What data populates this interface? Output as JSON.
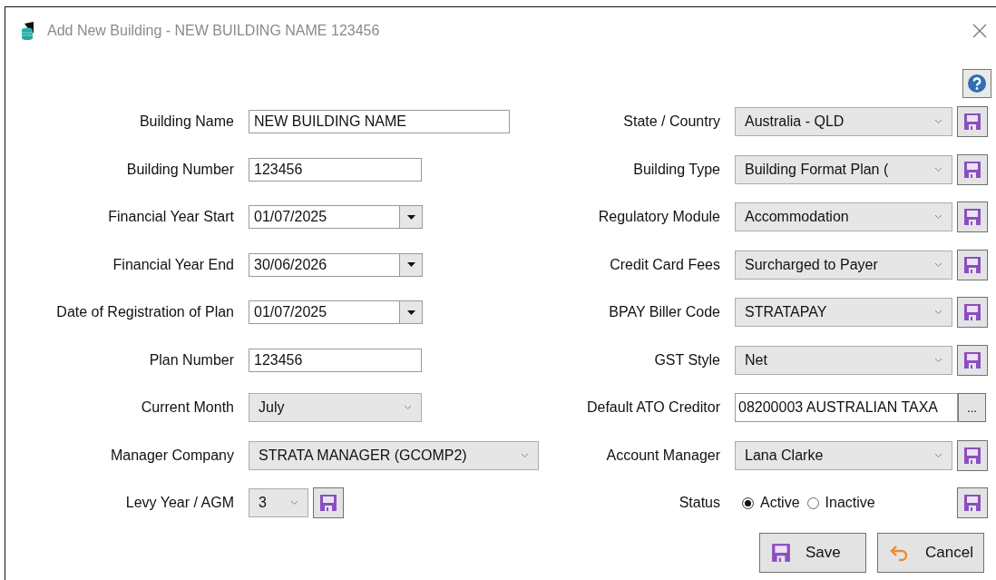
{
  "window": {
    "title": "Add New Building - NEW BUILDING NAME 123456"
  },
  "left_fields": [
    {
      "label": "Building Name",
      "kind": "text",
      "value": "NEW BUILDING NAME"
    },
    {
      "label": "Building Number",
      "kind": "text",
      "value": "123456"
    },
    {
      "label": "Financial Year Start",
      "kind": "date",
      "value": "01/07/2025"
    },
    {
      "label": "Financial Year End",
      "kind": "date",
      "value": "30/06/2026"
    },
    {
      "label": "Date of Registration of Plan",
      "kind": "date",
      "value": "01/07/2025"
    },
    {
      "label": "Plan Number",
      "kind": "text",
      "value": "123456"
    },
    {
      "label": "Current Month",
      "kind": "select",
      "value": "July"
    },
    {
      "label": "Manager Company",
      "kind": "select",
      "value": "STRATA MANAGER (GCOMP2)"
    },
    {
      "label": "Levy Year / AGM",
      "kind": "select_save",
      "value": "3"
    }
  ],
  "right_fields": [
    {
      "label": "State / Country",
      "kind": "select",
      "value": "Australia - QLD"
    },
    {
      "label": "Building Type",
      "kind": "select",
      "value": "Building Format Plan ("
    },
    {
      "label": "Regulatory Module",
      "kind": "select",
      "value": "Accommodation"
    },
    {
      "label": "Credit Card Fees",
      "kind": "select",
      "value": "Surcharged to Payer"
    },
    {
      "label": "BPAY Biller Code",
      "kind": "select",
      "value": "STRATAPAY"
    },
    {
      "label": "GST Style",
      "kind": "select",
      "value": "Net"
    },
    {
      "label": "Default ATO Creditor",
      "kind": "lookup",
      "value": "08200003 AUSTRALIAN TAXA",
      "button": "..."
    },
    {
      "label": "Account Manager",
      "kind": "select",
      "value": "Lana Clarke"
    },
    {
      "label": "Status",
      "kind": "radio",
      "options": [
        {
          "label": "Active",
          "selected": true
        },
        {
          "label": "Inactive",
          "selected": false
        }
      ]
    }
  ],
  "buttons": [
    {
      "label": "Save",
      "kind": "save"
    },
    {
      "label": "Cancel",
      "kind": "cancel"
    }
  ]
}
